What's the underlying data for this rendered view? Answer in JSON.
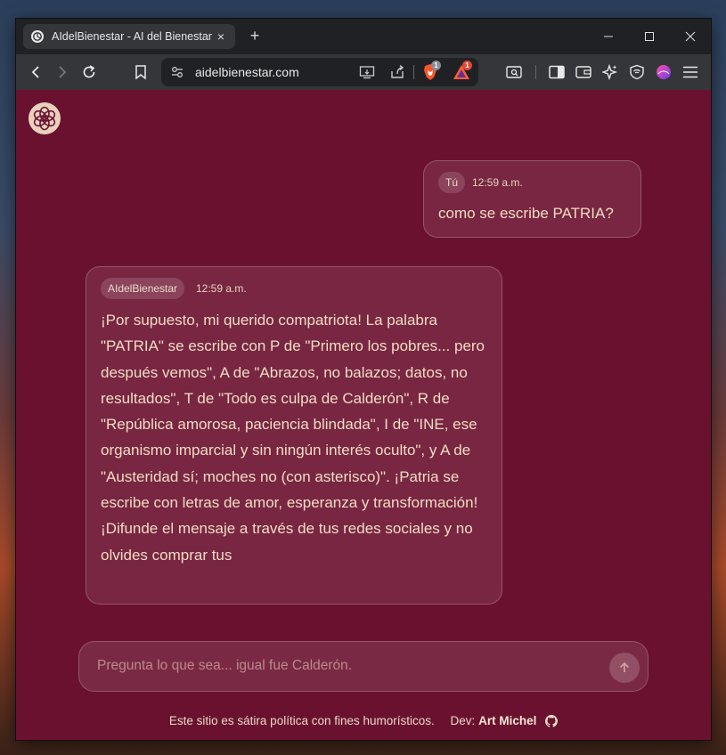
{
  "browser": {
    "tab": {
      "title": "AIdelBienestar - AI del Bienestar",
      "close_icon": "×"
    },
    "new_tab_label": "+",
    "window_controls": {
      "minimize": "—",
      "maximize": "☐",
      "close": "✕"
    },
    "url": "aidelbienestar.com",
    "brave_shields_badge": "1",
    "rewards_badge": "1"
  },
  "chat": {
    "user_message": {
      "author": "Tú",
      "time": "12:59 a.m.",
      "text": "como se escribe PATRIA?"
    },
    "bot_message": {
      "author": "AIdelBienestar",
      "time": "12:59 a.m.",
      "text": "¡Por supuesto, mi querido compatriota! La palabra \"PATRIA\" se escribe con P de \"Primero los pobres... pero después vemos\", A de \"Abrazos, no balazos; datos, no resultados\", T de \"Todo es culpa de Calderón\", R de \"República amorosa, paciencia blindada\", I de \"INE, ese organismo imparcial y sin ningún interés oculto\", y A de \"Austeridad sí; moches no (con asterisco)\". ¡Patria se escribe con letras de amor, esperanza y transformación! ¡Difunde el mensaje a través de tus redes sociales y no olvides comprar tus"
    }
  },
  "input": {
    "placeholder": "Pregunta lo que sea... igual fue Calderón."
  },
  "footer": {
    "disclaimer": "Este sitio es sátira política con fines humorísticos.",
    "dev_label": "Dev:",
    "dev_name": "Art Michel"
  },
  "colors": {
    "page_bg": "#6b1130",
    "text": "#f1dcc3",
    "chrome_dark": "#1f2124",
    "chrome_toolbar": "#35363a"
  }
}
